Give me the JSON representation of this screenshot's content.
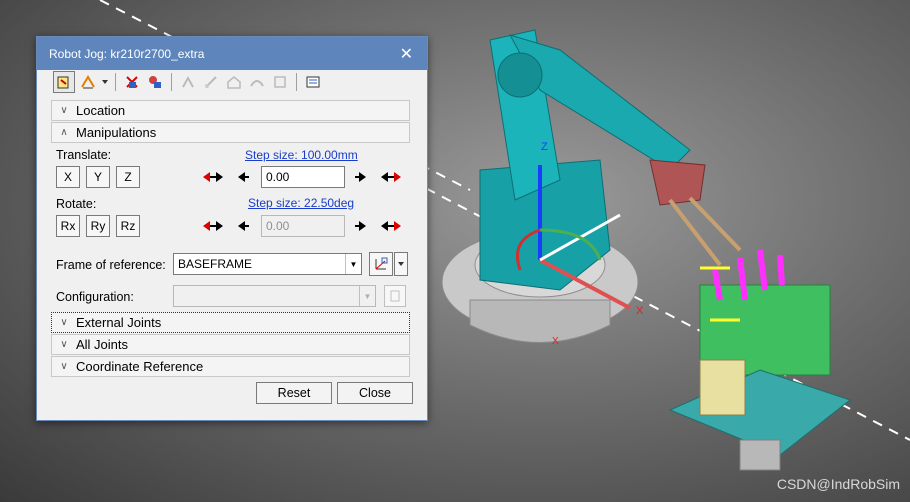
{
  "dialog": {
    "title": "Robot Jog: kr210r2700_extra",
    "sections": {
      "location": "Location",
      "manipulations": "Manipulations",
      "external_joints": "External Joints",
      "all_joints": "All Joints",
      "coordinate_reference": "Coordinate Reference"
    },
    "translate": {
      "label": "Translate:",
      "step_link": "Step size: 100.00mm",
      "axes": [
        "X",
        "Y",
        "Z"
      ],
      "value": "0.00"
    },
    "rotate": {
      "label": "Rotate:",
      "step_link": "Step size: 22.50deg",
      "axes": [
        "Rx",
        "Ry",
        "Rz"
      ],
      "value": "0.00"
    },
    "frame": {
      "label": "Frame of reference:",
      "value": "BASEFRAME"
    },
    "configuration": {
      "label": "Configuration:",
      "value": ""
    },
    "buttons": {
      "reset": "Reset",
      "close": "Close"
    }
  },
  "scene": {
    "axis_labels": {
      "z": "Z",
      "x1": "X",
      "x2": "X"
    }
  },
  "watermark": "CSDN@IndRobSim"
}
